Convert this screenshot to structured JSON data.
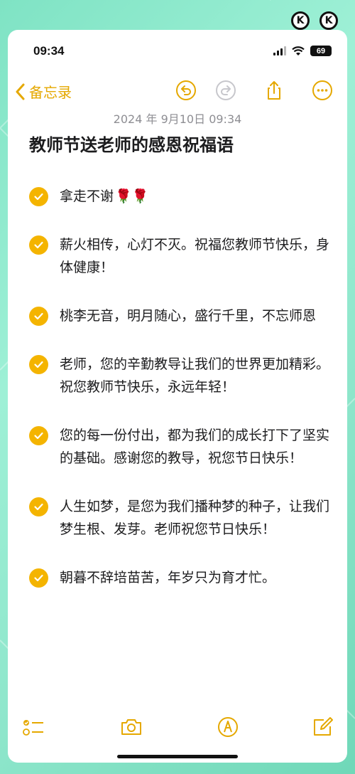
{
  "status_bar": {
    "time": "09:34",
    "battery": "69"
  },
  "toolbar": {
    "back_label": "备忘录",
    "icons": [
      "undo-icon",
      "redo-icon",
      "share-icon",
      "more-icon"
    ],
    "accent_color": "#e5a800"
  },
  "note": {
    "date": "2024 年 9月10日 09:34",
    "title": "教师节送老师的感恩祝福语",
    "items": [
      {
        "text": "拿走不谢",
        "checked": true,
        "emoji": "🌹🌹"
      },
      {
        "text": "薪火相传，心灯不灭。祝福您教师节快乐，身体健康！",
        "checked": true
      },
      {
        "text": "桃李无音，明月随心，盛行千里，不忘师恩",
        "checked": true
      },
      {
        "text": "老师，您的辛勤教导让我们的世界更加精彩。祝您教师节快乐，永远年轻！",
        "checked": true
      },
      {
        "text": "您的每一份付出，都为我们的成长打下了坚实的基础。感谢您的教导，祝您节日快乐！",
        "checked": true
      },
      {
        "text": "人生如梦，是您为我们播种梦的种子，让我们梦生根、发芽。老师祝您节日快乐！",
        "checked": true
      },
      {
        "text": "朝暮不辞培苗苦，年岁只为育才忙。",
        "checked": true
      }
    ]
  },
  "bottom_bar": {
    "icons": [
      "checklist-icon",
      "camera-icon",
      "markup-pen-icon",
      "compose-icon"
    ]
  },
  "colors": {
    "background": "#8ee6cb",
    "check": "#f4b400",
    "text": "#1c1c1e",
    "date": "#8e8e93"
  }
}
